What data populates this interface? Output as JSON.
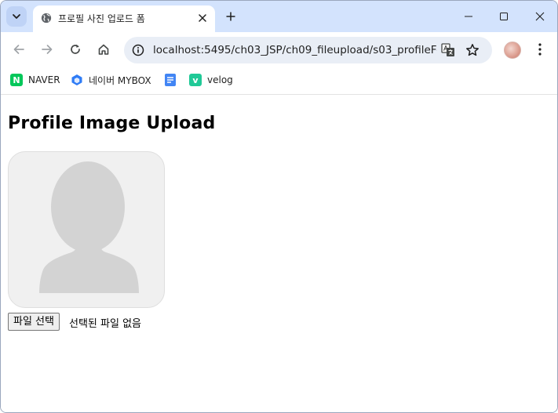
{
  "browser": {
    "tab": {
      "title": "프로필 사진 업로드 폼"
    },
    "address_bar": {
      "url": "localhost:5495/ch03_JSP/ch09_fileupload/s03_profileFor..."
    },
    "bookmarks": [
      {
        "label": "NAVER",
        "icon": "naver-icon",
        "color": "#03c75a"
      },
      {
        "label": "네이버 MYBOX",
        "icon": "mybox-icon",
        "color": "#2f7cf6"
      },
      {
        "label": "",
        "icon": "docs-icon",
        "color": "#4285f4"
      },
      {
        "label": "velog",
        "icon": "velog-icon",
        "color": "#20c997"
      }
    ]
  },
  "page": {
    "title": "Profile Image Upload",
    "file_input": {
      "button_label": "파일 선택",
      "status_text": "선택된 파일 없음"
    }
  },
  "colors": {
    "tabstrip_bg": "#d3e3fd",
    "omnibox_bg": "#e9eef6",
    "placeholder_bg": "#f0f0f0",
    "placeholder_silhouette": "#d3d3d3"
  }
}
